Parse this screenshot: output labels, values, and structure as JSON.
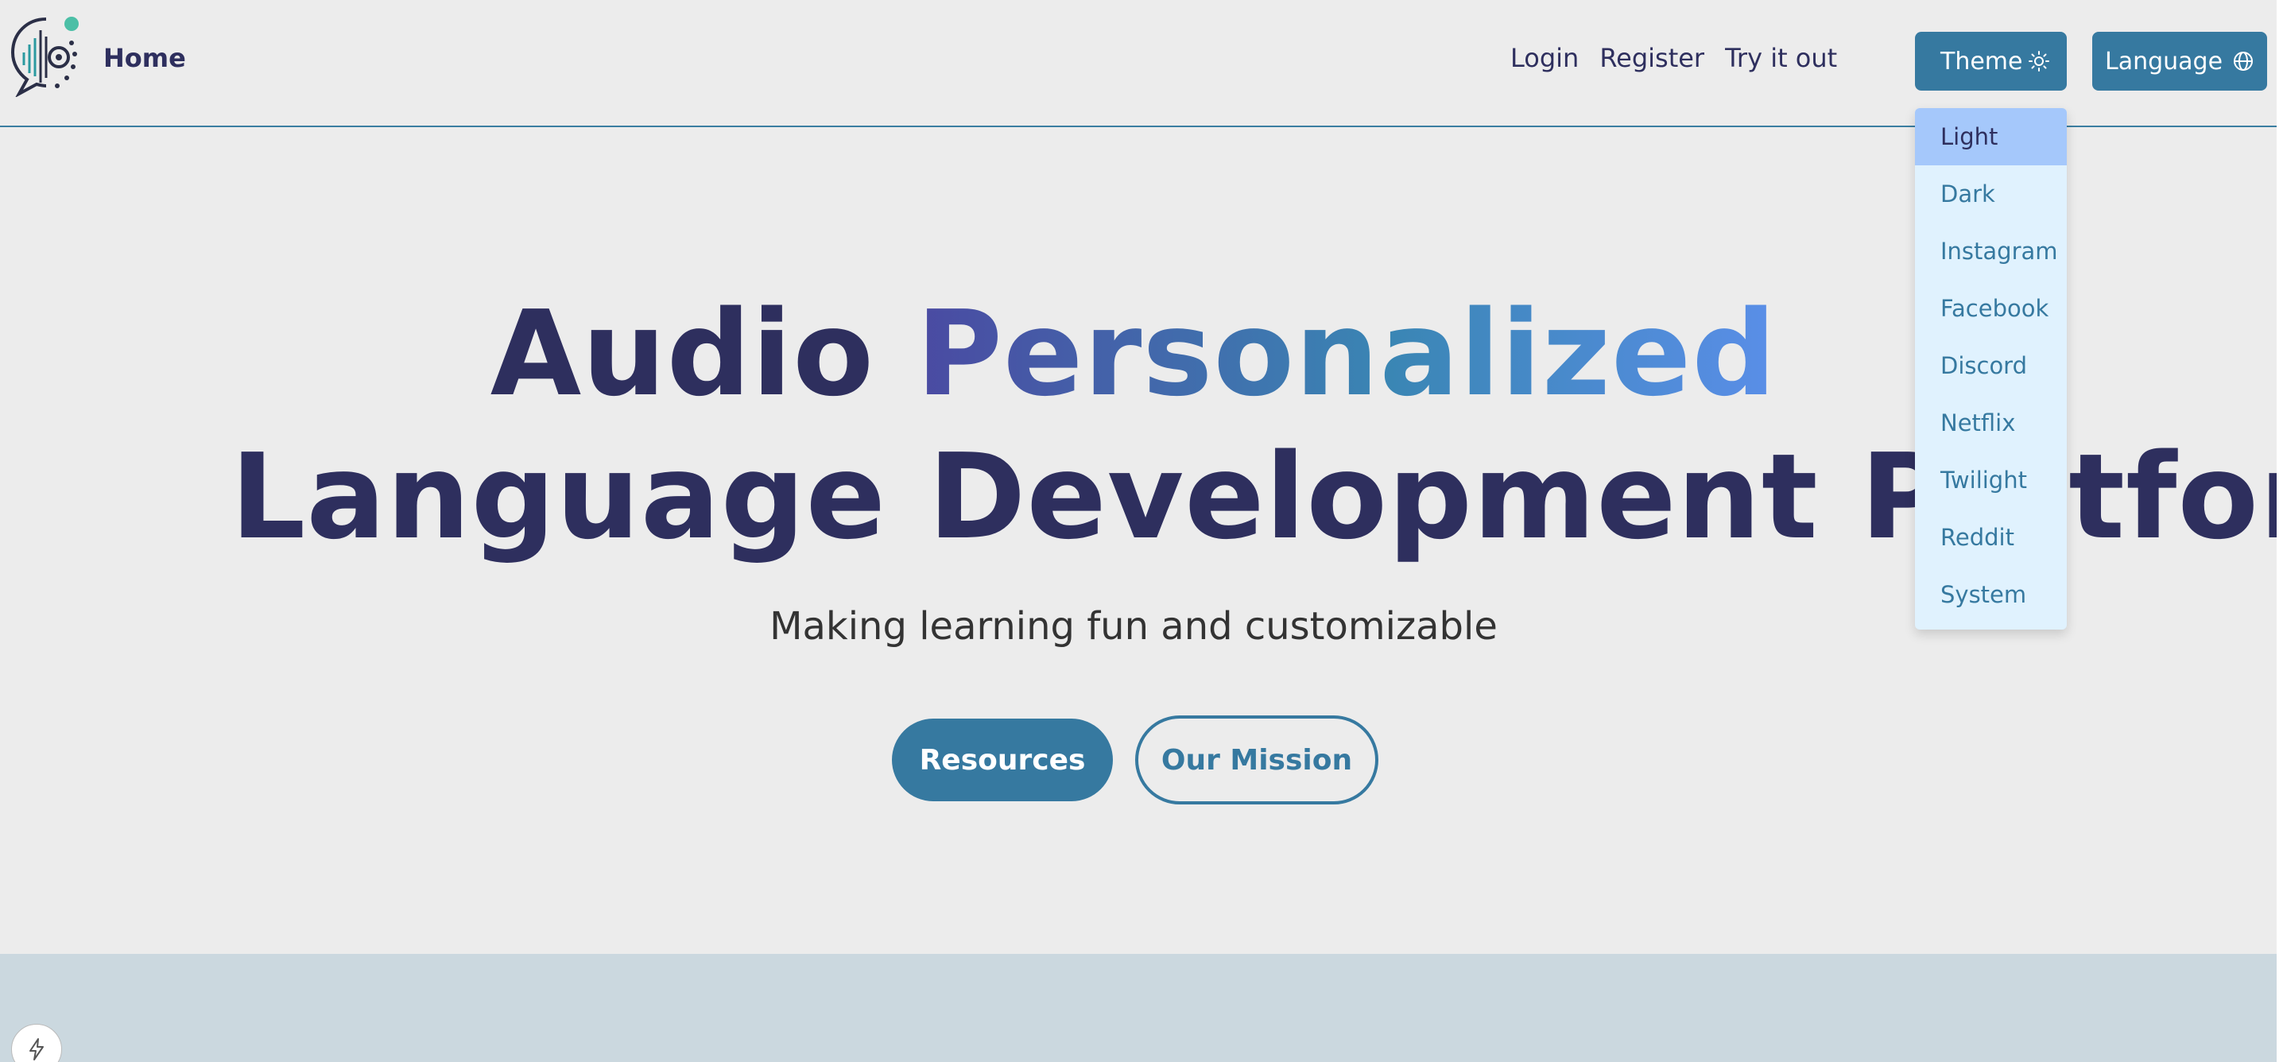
{
  "header": {
    "home_label": "Home",
    "nav_links": [
      "Login",
      "Register",
      "Try it out"
    ],
    "theme_button": "Theme",
    "language_button": "Language"
  },
  "theme_menu": {
    "items": [
      "Light",
      "Dark",
      "Instagram",
      "Facebook",
      "Discord",
      "Netflix",
      "Twilight",
      "Reddit",
      "System"
    ],
    "selected": "Light"
  },
  "hero": {
    "title_word1": "Audio",
    "title_word2": "Personalized",
    "title_line2": "Language Development Platform",
    "subtitle": "Making learning fun and customizable"
  },
  "actions": {
    "resources_label": "Resources",
    "mission_label": "Our Mission"
  },
  "icons": {
    "logo": "audio-speech-bubble-logo",
    "theme": "sun-icon",
    "language": "globe-icon",
    "bolt": "lightning-bolt-icon"
  },
  "colors": {
    "primary": "#3679a0",
    "heading": "#2e2f5e",
    "background": "#ececec",
    "menu_bg": "#e0f2fe",
    "menu_active": "#a5c8fb",
    "band": "#cbd8df"
  }
}
